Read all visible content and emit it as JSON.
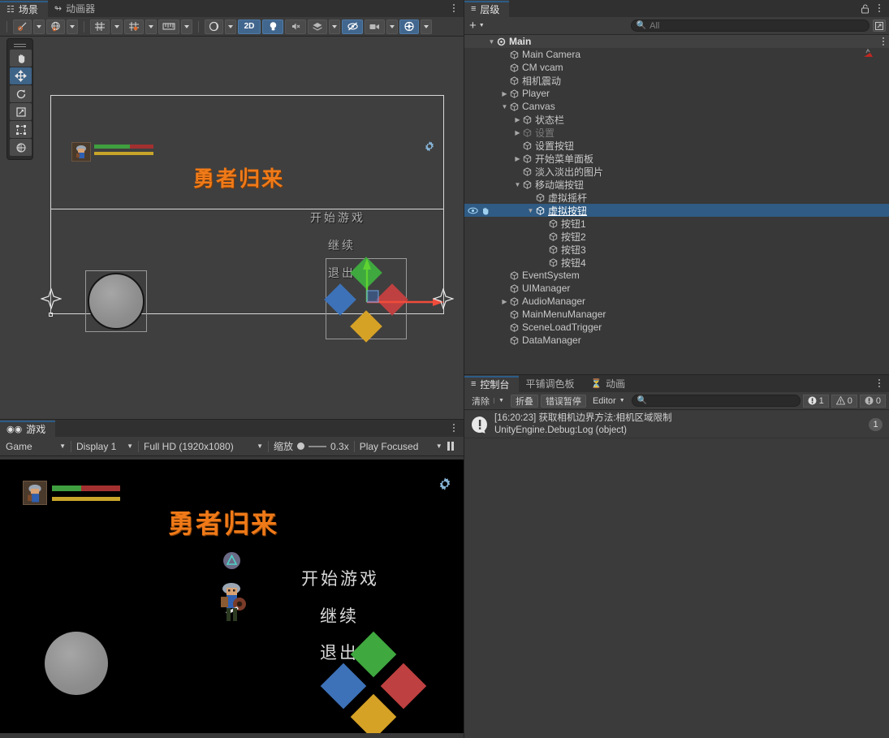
{
  "scene_panel": {
    "tabs": [
      {
        "label": "场景",
        "icon": "grid-icon",
        "active": true
      },
      {
        "label": "动画器",
        "icon": "animator-icon",
        "active": false
      }
    ],
    "toolbar": [
      {
        "name": "pivot-rotation-toggle",
        "icon": "pivot-icon",
        "has_caret": true,
        "on": false
      },
      {
        "name": "handle-space-toggle",
        "icon": "globe-icon",
        "has_caret": true,
        "on": false
      },
      {
        "name": "grid-snapping",
        "icon": "grid-axis-icon",
        "has_caret": true,
        "on": false
      },
      {
        "name": "grid-visibility",
        "icon": "grid-snap-icon",
        "has_caret": true,
        "on": false
      },
      {
        "name": "ruler-tool",
        "icon": "ruler-icon",
        "has_caret": true,
        "on": false
      },
      {
        "name": "shading-mode",
        "icon": "sphere-icon",
        "has_caret": true,
        "on": false
      },
      {
        "name": "toggle-2d",
        "label": "2D",
        "on": true
      },
      {
        "name": "toggle-lighting",
        "icon": "bulb-icon",
        "on": true
      },
      {
        "name": "toggle-audio",
        "icon": "mute-audio-icon",
        "on": false
      },
      {
        "name": "fx-dropdown",
        "icon": "fx-layers-icon",
        "has_caret": true,
        "on": false
      },
      {
        "name": "scene-visibility",
        "icon": "hidden-eye-icon",
        "on": true
      },
      {
        "name": "camera-settings",
        "icon": "camera-icon",
        "has_caret": true,
        "on": false
      },
      {
        "name": "gizmos-toggle",
        "icon": "gizmo-globe-icon",
        "has_caret": true,
        "on": true
      }
    ],
    "tools": [
      {
        "name": "hand-tool",
        "icon": "hand-icon",
        "on": false
      },
      {
        "name": "move-tool",
        "icon": "move-arrows-icon",
        "on": true
      },
      {
        "name": "rotate-tool",
        "icon": "rotate-icon",
        "on": false
      },
      {
        "name": "scale-tool",
        "icon": "scale-icon",
        "on": false
      },
      {
        "name": "rect-tool",
        "icon": "rect-transform-icon",
        "on": false
      },
      {
        "name": "transform-tool",
        "icon": "transform-icon",
        "on": false
      }
    ],
    "content": {
      "title": "勇者归来",
      "menu_items": [
        "开始游戏",
        "继续",
        "退出"
      ],
      "gear": "settings-gear-icon",
      "hp_bar_green": "#3f9e3f",
      "hp_bar_red": "#a33030",
      "mp_bar": "#c8a52a",
      "dpad": [
        {
          "name": "button-up",
          "color": "#3fa83f"
        },
        {
          "name": "button-left",
          "color": "#3d72b8"
        },
        {
          "name": "button-right",
          "color": "#bf4040"
        },
        {
          "name": "button-down",
          "color": "#d6a226"
        }
      ]
    }
  },
  "game_panel": {
    "tabs": [
      {
        "label": "游戏",
        "icon": "gamepad-icon",
        "active": true
      }
    ],
    "toolbar": {
      "mode": "Game",
      "display": "Display 1",
      "resolution": "Full HD (1920x1080)",
      "scale_label": "缩放",
      "scale_value": "0.3x",
      "play_mode": "Play Focused"
    },
    "content": {
      "title": "勇者归来",
      "menu_items": [
        "开始游戏",
        "继续",
        "退出"
      ],
      "gear": "settings-gear-icon",
      "interact_prompt": "triangle-button-icon",
      "dpad": [
        {
          "name": "button-up",
          "color": "#3fa83f"
        },
        {
          "name": "button-left",
          "color": "#3d72b8"
        },
        {
          "name": "button-right",
          "color": "#bf4040"
        },
        {
          "name": "button-down",
          "color": "#d6a226"
        }
      ]
    }
  },
  "hierarchy": {
    "tab_label": "层级",
    "lock_icon": "lock-open-icon",
    "create_label": "+",
    "search_placeholder": "All",
    "rows": [
      {
        "label": "Main",
        "depth": 0,
        "arrow": "down",
        "type": "scene",
        "selected": false,
        "dim": false,
        "header": true
      },
      {
        "label": "Main Camera",
        "depth": 1,
        "arrow": "none",
        "type": "object",
        "selected": false,
        "dim": false,
        "badge": "cinemachine-icon"
      },
      {
        "label": "CM vcam",
        "depth": 1,
        "arrow": "none",
        "type": "object",
        "selected": false,
        "dim": false
      },
      {
        "label": "相机震动",
        "depth": 1,
        "arrow": "none",
        "type": "object",
        "selected": false,
        "dim": false
      },
      {
        "label": "Player",
        "depth": 1,
        "arrow": "right",
        "type": "object",
        "selected": false,
        "dim": false
      },
      {
        "label": "Canvas",
        "depth": 1,
        "arrow": "down",
        "type": "object",
        "selected": false,
        "dim": false
      },
      {
        "label": "状态栏",
        "depth": 2,
        "arrow": "right",
        "type": "object",
        "selected": false,
        "dim": false
      },
      {
        "label": "设置",
        "depth": 2,
        "arrow": "right",
        "type": "object",
        "selected": false,
        "dim": true
      },
      {
        "label": "设置按钮",
        "depth": 2,
        "arrow": "none",
        "type": "object",
        "selected": false,
        "dim": false
      },
      {
        "label": "开始菜单面板",
        "depth": 2,
        "arrow": "right",
        "type": "object",
        "selected": false,
        "dim": false
      },
      {
        "label": "淡入淡出的图片",
        "depth": 2,
        "arrow": "none",
        "type": "object",
        "selected": false,
        "dim": false
      },
      {
        "label": "移动端按钮",
        "depth": 2,
        "arrow": "down",
        "type": "object",
        "selected": false,
        "dim": false
      },
      {
        "label": "虚拟摇杆",
        "depth": 3,
        "arrow": "none",
        "type": "object",
        "selected": false,
        "dim": false
      },
      {
        "label": "虚拟按钮",
        "depth": 3,
        "arrow": "down",
        "type": "object",
        "selected": true,
        "dim": false,
        "eye": true
      },
      {
        "label": "按钮1",
        "depth": 4,
        "arrow": "none",
        "type": "object",
        "selected": false,
        "dim": false
      },
      {
        "label": "按钮2",
        "depth": 4,
        "arrow": "none",
        "type": "object",
        "selected": false,
        "dim": false
      },
      {
        "label": "按钮3",
        "depth": 4,
        "arrow": "none",
        "type": "object",
        "selected": false,
        "dim": false
      },
      {
        "label": "按钮4",
        "depth": 4,
        "arrow": "none",
        "type": "object",
        "selected": false,
        "dim": false
      },
      {
        "label": "EventSystem",
        "depth": 1,
        "arrow": "none",
        "type": "object",
        "selected": false,
        "dim": false
      },
      {
        "label": "UIManager",
        "depth": 1,
        "arrow": "none",
        "type": "object",
        "selected": false,
        "dim": false
      },
      {
        "label": "AudioManager",
        "depth": 1,
        "arrow": "right",
        "type": "object",
        "selected": false,
        "dim": false
      },
      {
        "label": "MainMenuManager",
        "depth": 1,
        "arrow": "none",
        "type": "object",
        "selected": false,
        "dim": false
      },
      {
        "label": "SceneLoadTrigger",
        "depth": 1,
        "arrow": "none",
        "type": "object",
        "selected": false,
        "dim": false
      },
      {
        "label": "DataManager",
        "depth": 1,
        "arrow": "none",
        "type": "object",
        "selected": false,
        "dim": false
      }
    ]
  },
  "console": {
    "tabs": [
      {
        "label": "控制台",
        "icon": "console-icon",
        "active": true
      },
      {
        "label": "平铺调色板",
        "icon": "",
        "active": false
      },
      {
        "label": "动画",
        "icon": "clock-icon",
        "active": false
      }
    ],
    "toolbar": {
      "clear": "清除",
      "collapse": "折叠",
      "error_pause": "错误暂停",
      "editor": "Editor",
      "search_placeholder": "",
      "counts": {
        "info": "1",
        "warning": "0",
        "error": "0"
      }
    },
    "entries": [
      {
        "icon": "info-icon",
        "line1": "[16:20:23] 获取相机边界方法:相机区域限制",
        "line2": "UnityEngine.Debug:Log (object)",
        "count": "1"
      }
    ]
  },
  "colors": {
    "accent_blue": "#2f5b84",
    "panel_bg": "#383838",
    "toolbar_bg": "#3c3c3c",
    "tab_bg": "#303030",
    "title_orange": "#f07a18"
  }
}
